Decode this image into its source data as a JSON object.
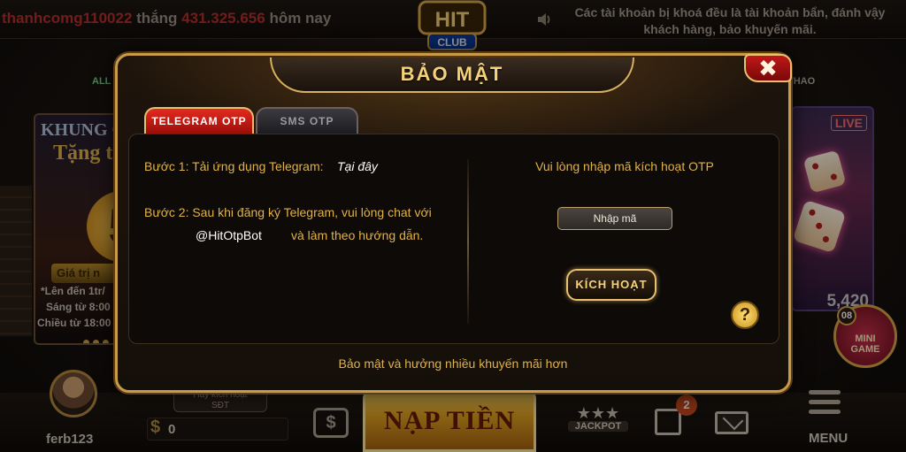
{
  "ticker": {
    "username": "thanhcomg110022",
    "verb": "thắng",
    "amount": "431.325.656",
    "suffix": "hôm nay"
  },
  "header_notice": "Các tài khoản bị khoá đều là tài khoản bẩn, đánh vậy khách hàng, bảo khuyến mãi.",
  "logo": {
    "top": "HIT",
    "bottom": "CLUB"
  },
  "background": {
    "left_tab": "ALL",
    "right_tab": "THAO",
    "promo": {
      "title": "KHUNG GI",
      "gift": "Tặng t",
      "number": "5",
      "value": "Giá trị n",
      "line1": "*Lên đến 1tr/",
      "line2": "Sáng từ 8:00",
      "line3": "Chiều từ 18:00"
    },
    "live": {
      "badge": "LIVE",
      "number": "5,420"
    },
    "mini_game": {
      "count": "08",
      "label_line1": "MINI",
      "label_line2": "GAME"
    }
  },
  "bottom_bar": {
    "username": "ferb123",
    "verify_line1": "Hãy kích hoạt",
    "verify_line2": "SĐT",
    "currency_icon": "$",
    "balance": "0",
    "cashier_icon": "$",
    "deposit_label": "NẠP TIỀN",
    "jackpot_label": "JACKPOT",
    "gift_badge": "2",
    "menu_label": "MENU"
  },
  "modal": {
    "title": "BẢO MẬT",
    "close_icon": "✖",
    "tabs": [
      {
        "label": "TELEGRAM OTP",
        "active": true
      },
      {
        "label": "SMS OTP",
        "active": false
      }
    ],
    "step1_text": "Bước 1: Tải ứng dụng Telegram:",
    "step1_link": "Tại đây",
    "step2_text": "Bước 2: Sau khi đăng ký Telegram, vui lòng chat với",
    "step2_bot": "@HitOtpBot",
    "step2_tail": "và làm theo hướng dẫn.",
    "otp_label": "Vui lòng nhập mã kích hoạt OTP",
    "otp_placeholder": "Nhập mã",
    "activate_label": "KÍCH HOẠT",
    "help_icon": "?",
    "footer": "Bảo mật và hưởng nhiều khuyến mãi hơn"
  },
  "colors": {
    "gold": "#e0b24a",
    "gold_border": "#c89a4a",
    "active_tab": "#e42a20",
    "close_red": "#c01818"
  }
}
